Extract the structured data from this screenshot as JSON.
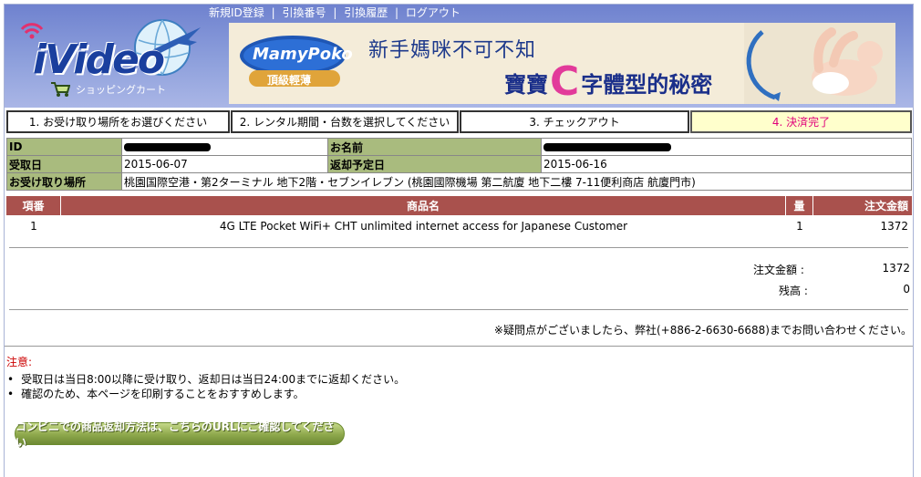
{
  "topnav": {
    "links": [
      "新規ID登録",
      "引換番号",
      "引換履歴",
      "ログアウト"
    ],
    "separator": "|"
  },
  "logo": {
    "text": "iVideo"
  },
  "cart": {
    "label": "ショッピングカート"
  },
  "banner": {
    "brand": "MamyPoko",
    "brand_sub": "頂級輕薄",
    "line1": "新手媽咪不可不知",
    "line2_pre": "寶寶",
    "line2_big": "C",
    "line2_post": "字體型的秘密"
  },
  "steps": [
    {
      "label": "1. お受け取り場所をお選びください"
    },
    {
      "label": "2. レンタル期間・台数を選択してください"
    },
    {
      "label": "3. チェックアウト"
    },
    {
      "label": "4. 決済完了"
    }
  ],
  "info": {
    "id_label": "ID",
    "name_label": "お名前",
    "pickup_label": "受取日",
    "pickup_value": "2015-06-07",
    "return_label": "返却予定日",
    "return_value": "2015-06-16",
    "place_label": "お受け取り場所",
    "place_value": "桃園国際空港・第2ターミナル 地下2階・セブンイレブン (桃園國際機場 第二航廈 地下二樓 7-11便利商店 航廈門市)"
  },
  "items": {
    "headers": {
      "no": "項番",
      "name": "商品名",
      "qty": "量",
      "amount": "注文金額"
    },
    "rows": [
      {
        "no": "1",
        "name": "4G LTE Pocket WiFi+ CHT unlimited internet access for Japanese Customer",
        "qty": "1",
        "amount": "1372"
      }
    ]
  },
  "summary": {
    "total_label": "注文金額 :",
    "total_value": "1372",
    "balance_label": "残高 :",
    "balance_value": "0"
  },
  "contact_note": "※疑問点がございましたら、弊社(+886-2-6630-6688)までお問い合わせください。",
  "notice": {
    "title": "注意:",
    "items": [
      "受取日は当日8:00以降に受け取り、返却日は当日24:00までに返却ください。",
      "確認のため、本ページを印刷することをおすすめします。"
    ]
  },
  "return_button": {
    "label": "コンビニでの商品返却方法は、こちらのURLにご確認してください"
  },
  "colors": {
    "header_blue": "#7f91d6",
    "step_active_bg": "#ffffcc",
    "step_active_text": "#e0007a",
    "label_green": "#a9bb7e",
    "table_header_red": "#a9514d",
    "button_green": "#8ea84c",
    "notice_red": "#cc0000"
  }
}
